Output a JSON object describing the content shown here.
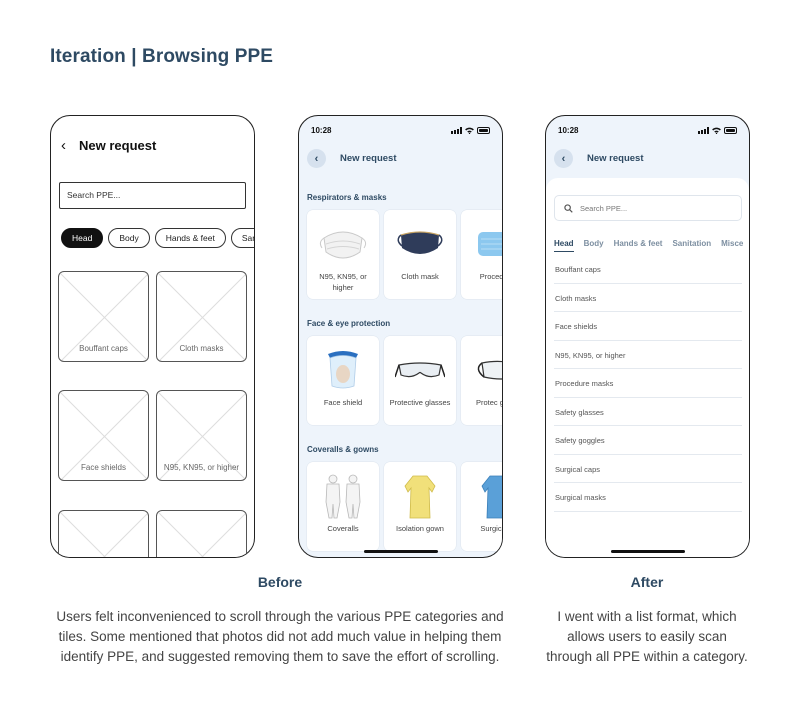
{
  "page": {
    "title": "Iteration | Browsing PPE"
  },
  "before_wireframe": {
    "title": "New request",
    "search_placeholder": "Search PPE...",
    "chips": [
      "Head",
      "Body",
      "Hands & feet",
      "Sanit"
    ],
    "tiles": [
      "Bouffant caps",
      "Cloth masks",
      "Face shields",
      "N95, KN95, or higher",
      "",
      ""
    ]
  },
  "before_mock": {
    "time": "10:28",
    "title": "New request",
    "sections": [
      {
        "heading": "Respirators & masks",
        "items": [
          {
            "label": "N95, KN95, or higher",
            "icon": "n95-mask-icon"
          },
          {
            "label": "Cloth mask",
            "icon": "cloth-mask-icon"
          },
          {
            "label": "Procedure",
            "icon": "procedure-mask-icon"
          }
        ]
      },
      {
        "heading": "Face & eye protection",
        "items": [
          {
            "label": "Face shield",
            "icon": "face-shield-icon"
          },
          {
            "label": "Protective glasses",
            "icon": "protective-glasses-icon"
          },
          {
            "label": "Protec goggl",
            "icon": "goggles-icon"
          }
        ]
      },
      {
        "heading": "Coveralls & gowns",
        "items": [
          {
            "label": "Coveralls",
            "icon": "coveralls-icon"
          },
          {
            "label": "Isolation gown",
            "icon": "isolation-gown-icon"
          },
          {
            "label": "Surgical g",
            "icon": "surgical-gown-icon"
          }
        ]
      }
    ]
  },
  "after_mock": {
    "time": "10:28",
    "title": "New request",
    "search_placeholder": "Search PPE...",
    "tabs": [
      "Head",
      "Body",
      "Hands & feet",
      "Sanitation",
      "Misce"
    ],
    "list": [
      "Bouffant caps",
      "Cloth masks",
      "Face shields",
      "N95, KN95, or higher",
      "Procedure masks",
      "Safety glasses",
      "Safety goggles",
      "Surgical caps",
      "Surgical masks"
    ]
  },
  "captions": {
    "before_label": "Before",
    "before_text_lines": [
      "Users felt inconvenienced to scroll through the various PPE categories and",
      "tiles. Some mentioned that photos did not add much value in helping them",
      "identify PPE, and suggested removing them to save the effort of scrolling."
    ],
    "after_label": "After",
    "after_text_lines": [
      "I went with a list format, which",
      "allows users to easily scan",
      "through all PPE within a category."
    ]
  },
  "colors": {
    "heading": "#2e4a63",
    "app_background": "#eef4fb",
    "chip_active": "#111111"
  }
}
